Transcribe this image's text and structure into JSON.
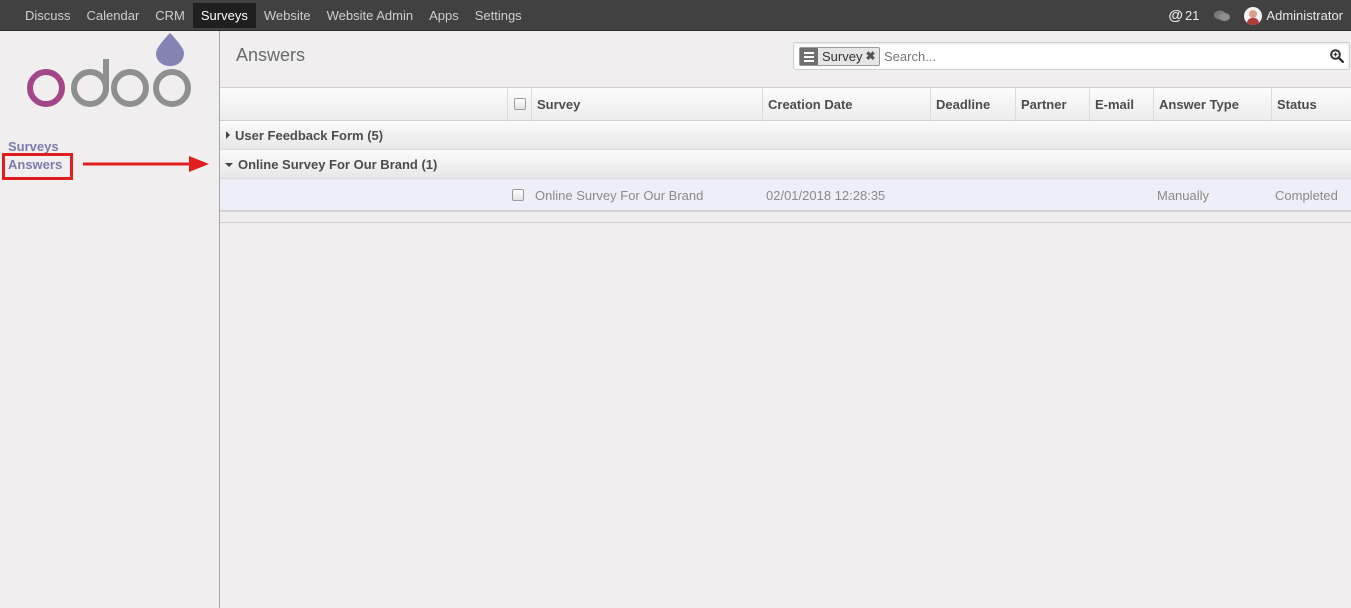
{
  "topbar": {
    "menu": [
      "Discuss",
      "Calendar",
      "CRM",
      "Surveys",
      "Website",
      "Website Admin",
      "Apps",
      "Settings"
    ],
    "active_menu": "Surveys",
    "mention_symbol": "@",
    "notification_count": "21",
    "chat_icon": "chat-bubbles-icon",
    "user_name": "Administrator"
  },
  "sidebar": {
    "logo_text": "odoo",
    "items": [
      {
        "label": "Surveys"
      },
      {
        "label": "Answers"
      }
    ],
    "highlight_color": "#e11e1e"
  },
  "main": {
    "title": "Answers",
    "search": {
      "facet_icon": "group-by-icon",
      "facet_label": "Survey",
      "placeholder": "Search...",
      "value": ""
    },
    "table": {
      "columns": [
        "Survey",
        "Creation Date",
        "Deadline",
        "Partner",
        "E-mail",
        "Answer Type",
        "Status"
      ],
      "groups": [
        {
          "label": "User Feedback Form (5)",
          "expanded": false,
          "rows": []
        },
        {
          "label": "Online Survey For Our Brand (1)",
          "expanded": true,
          "rows": [
            {
              "survey": "Online Survey For Our Brand",
              "creation_date": "02/01/2018 12:28:35",
              "deadline": "",
              "partner": "",
              "email": "",
              "answer_type": "Manually",
              "status": "Completed"
            }
          ]
        }
      ]
    }
  },
  "colors": {
    "navbar": "#414141",
    "accent": "#7c7bad",
    "logo_purple": "#a24689",
    "logo_gray": "#8f8f8f"
  }
}
